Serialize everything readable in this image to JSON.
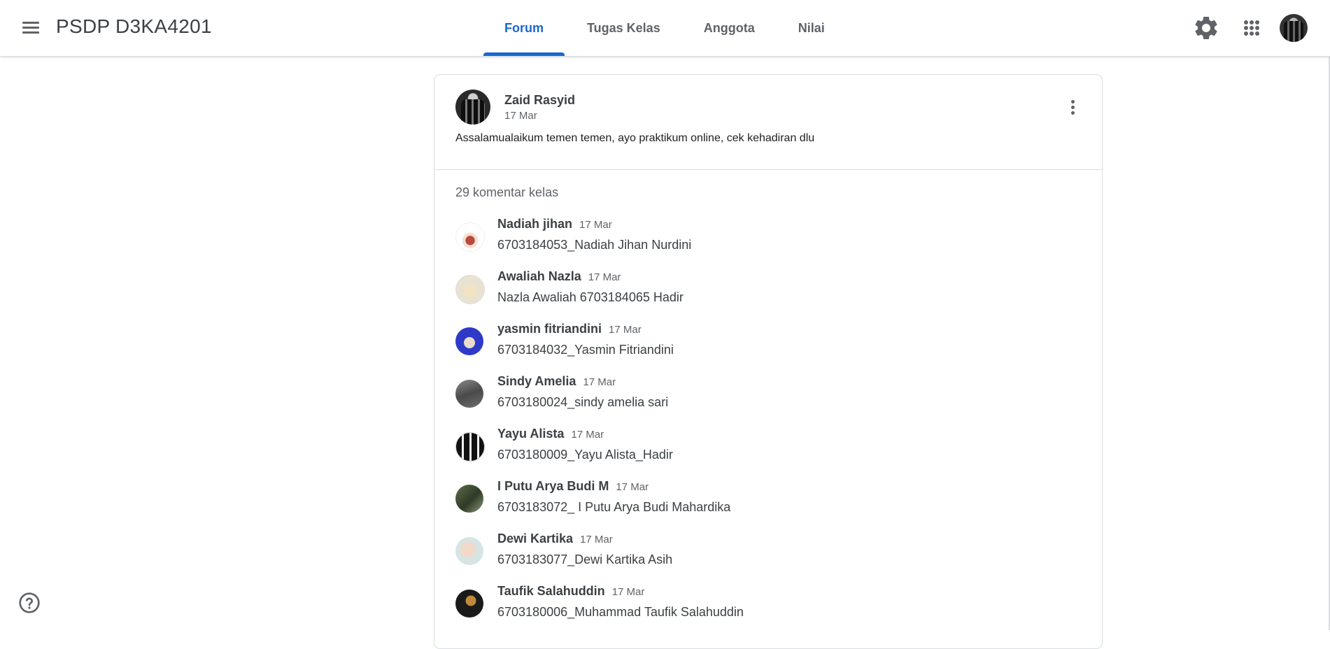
{
  "header": {
    "class_title": "PSDP D3KA4201",
    "tabs": [
      {
        "label": "Forum",
        "active": true
      },
      {
        "label": "Tugas Kelas",
        "active": false
      },
      {
        "label": "Anggota",
        "active": false
      },
      {
        "label": "Nilai",
        "active": false
      }
    ],
    "accent_color": "#1967d2"
  },
  "post": {
    "author": "Zaid Rasyid",
    "date": "17 Mar",
    "text": "Assalamualaikum temen temen, ayo praktikum online, cek kehadiran dlu",
    "comments_label": "29 komentar kelas"
  },
  "comments": [
    {
      "name": "Nadiah jihan",
      "date": "17 Mar",
      "text": "6703184053_Nadiah Jihan Nurdini"
    },
    {
      "name": "Awaliah Nazla",
      "date": "17 Mar",
      "text": "Nazla Awaliah 6703184065 Hadir"
    },
    {
      "name": "yasmin fitriandini",
      "date": "17 Mar",
      "text": "6703184032_Yasmin Fitriandini"
    },
    {
      "name": "Sindy Amelia",
      "date": "17 Mar",
      "text": "6703180024_sindy amelia sari"
    },
    {
      "name": "Yayu Alista",
      "date": "17 Mar",
      "text": "6703180009_Yayu Alista_Hadir"
    },
    {
      "name": "I Putu Arya Budi M",
      "date": "17 Mar",
      "text": "6703183072_ I Putu Arya Budi Mahardika"
    },
    {
      "name": "Dewi Kartika",
      "date": "17 Mar",
      "text": "6703183077_Dewi Kartika Asih"
    },
    {
      "name": "Taufik Salahuddin",
      "date": "17 Mar",
      "text": "6703180006_Muhammad Taufik Salahuddin"
    }
  ],
  "icons": {
    "menu": "menu-icon",
    "settings": "gear-icon",
    "apps": "apps-grid-icon",
    "more": "more-vert-icon",
    "help": "help-circle-icon"
  }
}
